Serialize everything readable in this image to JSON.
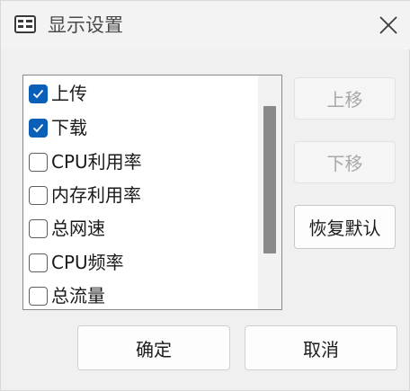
{
  "window": {
    "title": "显示设置",
    "icon": "window-settings-icon"
  },
  "list": {
    "items": [
      {
        "label": "上传",
        "checked": true
      },
      {
        "label": "下载",
        "checked": true
      },
      {
        "label": "CPU利用率",
        "checked": false
      },
      {
        "label": "内存利用率",
        "checked": false
      },
      {
        "label": "总网速",
        "checked": false
      },
      {
        "label": "CPU频率",
        "checked": false
      },
      {
        "label": "总流量",
        "checked": false
      }
    ]
  },
  "buttons": {
    "move_up": "上移",
    "move_down": "下移",
    "restore_default": "恢复默认",
    "ok": "确定",
    "cancel": "取消"
  },
  "colors": {
    "checkbox_checked": "#0a5fb8",
    "disabled_text": "#a8a8a8"
  }
}
